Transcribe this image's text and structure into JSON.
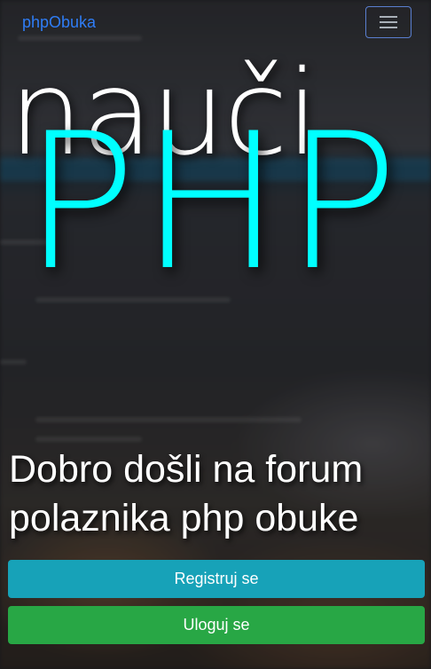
{
  "navbar": {
    "brand": "phpObuka",
    "toggler_icon": "hamburger-menu-icon"
  },
  "hero": {
    "line1": "nauči",
    "line2": "PHP",
    "line2_color": "#00ffff",
    "welcome": "Dobro došli na forum polaznika php obuke"
  },
  "actions": {
    "register_label": "Registruj se",
    "register_color": "#17a2b8",
    "login_label": "Uloguj se",
    "login_color": "#28a745"
  },
  "colors": {
    "brand": "#2f7df6"
  }
}
